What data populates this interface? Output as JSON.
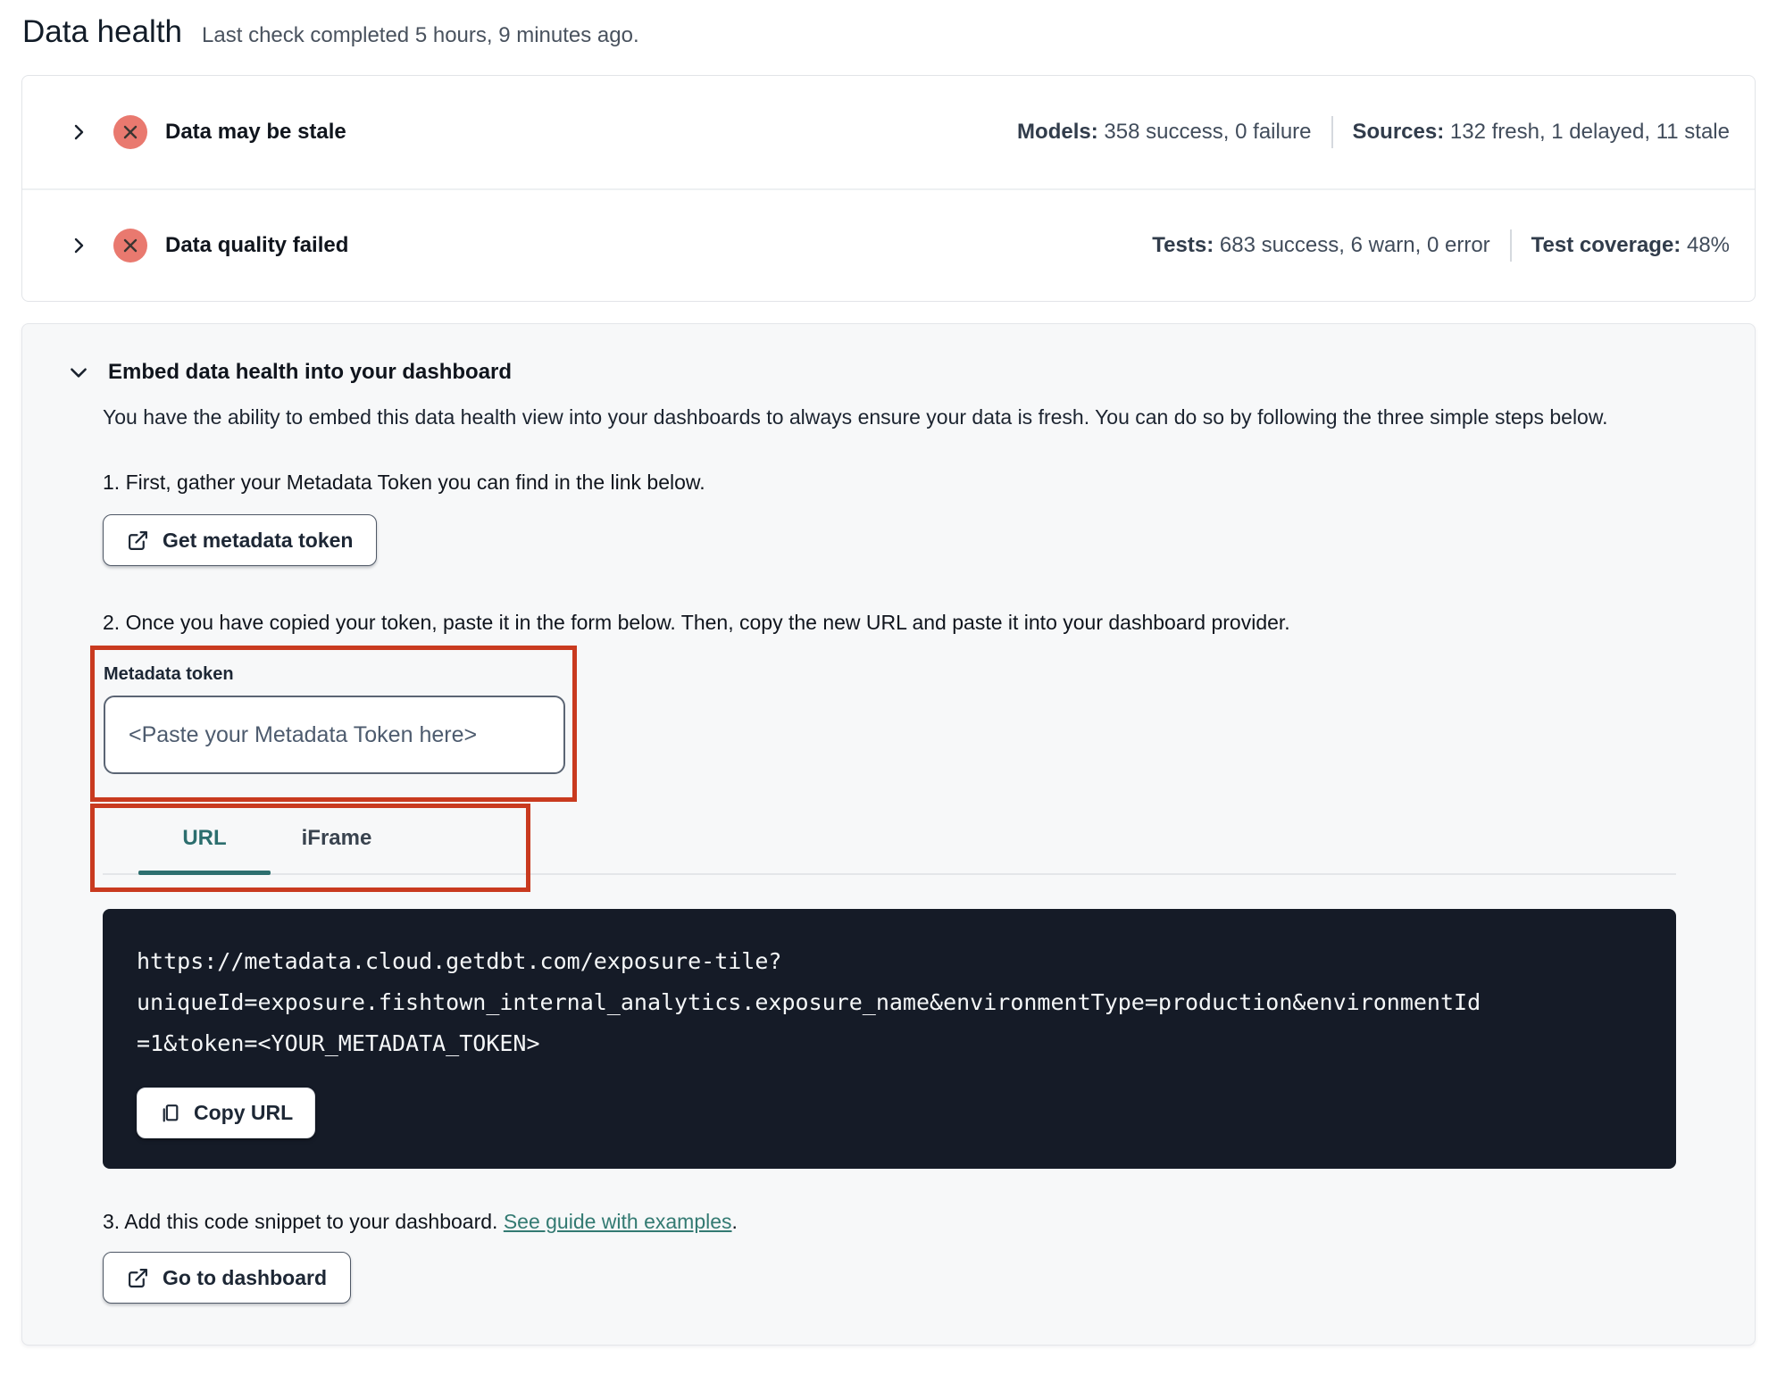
{
  "page": {
    "title": "Data health",
    "subtitle": "Last check completed 5 hours, 9 minutes ago."
  },
  "status_rows": [
    {
      "title": "Data may be stale",
      "status_icon": "failure-x-circle",
      "stats": [
        {
          "label": "Models:",
          "value": " 358 success, 0 failure"
        },
        {
          "label": "Sources:",
          "value": " 132 fresh, 1 delayed, 11 stale"
        }
      ]
    },
    {
      "title": "Data quality failed",
      "status_icon": "failure-x-circle",
      "stats": [
        {
          "label": "Tests:",
          "value": " 683 success, 6 warn, 0 error"
        },
        {
          "label": "Test coverage:",
          "value": " 48%"
        }
      ]
    }
  ],
  "embed": {
    "title": "Embed data health into your dashboard",
    "description": "You have the ability to embed this data health view into your dashboards to always ensure your data is fresh. You can do so by following the three simple steps below.",
    "step1": "1. First, gather your Metadata Token you can find in the link below.",
    "get_token_button": "Get metadata token",
    "step2": "2. Once you have copied your token, paste it in the form below. Then, copy the new URL and paste it into your dashboard provider.",
    "token_field": {
      "label": "Metadata token",
      "placeholder": "<Paste your Metadata Token here>",
      "value": ""
    },
    "tabs": [
      {
        "label": "URL",
        "active": true
      },
      {
        "label": "iFrame",
        "active": false
      }
    ],
    "code_block": {
      "lines": [
        "https://metadata.cloud.getdbt.com/exposure-tile?",
        "uniqueId=exposure.fishtown_internal_analytics.exposure_name&environmentType=production&environmentId",
        "=1&token=<YOUR_METADATA_TOKEN>"
      ],
      "copy_button": "Copy URL"
    },
    "step3_prefix": "3. Add this code snippet to your dashboard. ",
    "step3_link": "See guide with examples",
    "step3_suffix": ".",
    "dashboard_button": "Go to dashboard"
  },
  "colors": {
    "annotation_red": "#c93a1f",
    "failure_badge": "#e9796f",
    "accent_teal": "#2c6e6e",
    "link_teal": "#337a72",
    "code_background": "#151b27",
    "embed_card_background": "#f7f8f9",
    "title_text": "#10151d",
    "stats_text": "#414c5b"
  }
}
